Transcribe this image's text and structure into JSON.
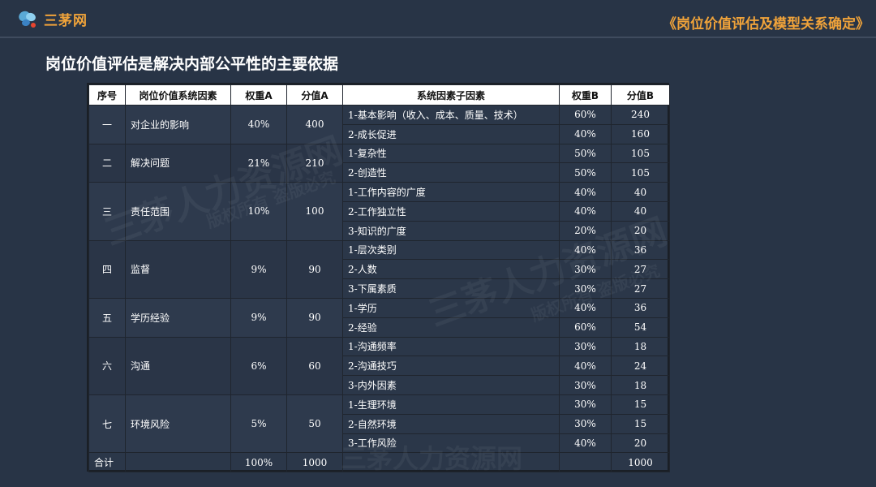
{
  "brand": {
    "name": "三茅网"
  },
  "header": {
    "title": "《岗位价值评估及模型关系确定》"
  },
  "page": {
    "title": "岗位价值评估是解决内部公平性的主要依据"
  },
  "table": {
    "headers": [
      "序号",
      "岗位价值系统因素",
      "权重A",
      "分值A",
      "系统因素子因素",
      "权重B",
      "分值B"
    ],
    "groups": [
      {
        "no": "一",
        "factor": "对企业的影响",
        "weight_a": "40%",
        "score_a": "400",
        "subs": [
          {
            "name": "1-基本影响（收入、成本、质量、技术）",
            "weight_b": "60%",
            "score_b": "240"
          },
          {
            "name": "2-成长促进",
            "weight_b": "40%",
            "score_b": "160"
          }
        ]
      },
      {
        "no": "二",
        "factor": "解决问题",
        "weight_a": "21%",
        "score_a": "210",
        "subs": [
          {
            "name": "1-复杂性",
            "weight_b": "50%",
            "score_b": "105"
          },
          {
            "name": "2-创造性",
            "weight_b": "50%",
            "score_b": "105"
          }
        ]
      },
      {
        "no": "三",
        "factor": "责任范围",
        "weight_a": "10%",
        "score_a": "100",
        "subs": [
          {
            "name": "1-工作内容的广度",
            "weight_b": "40%",
            "score_b": "40"
          },
          {
            "name": "2-工作独立性",
            "weight_b": "40%",
            "score_b": "40"
          },
          {
            "name": "3-知识的广度",
            "weight_b": "20%",
            "score_b": "20"
          }
        ]
      },
      {
        "no": "四",
        "factor": "监督",
        "weight_a": "9%",
        "score_a": "90",
        "subs": [
          {
            "name": "1-层次类别",
            "weight_b": "40%",
            "score_b": "36"
          },
          {
            "name": "2-人数",
            "weight_b": "30%",
            "score_b": "27"
          },
          {
            "name": "3-下属素质",
            "weight_b": "30%",
            "score_b": "27"
          }
        ]
      },
      {
        "no": "五",
        "factor": "学历经验",
        "weight_a": "9%",
        "score_a": "90",
        "subs": [
          {
            "name": "1-学历",
            "weight_b": "40%",
            "score_b": "36"
          },
          {
            "name": "2-经验",
            "weight_b": "60%",
            "score_b": "54"
          }
        ]
      },
      {
        "no": "六",
        "factor": "沟通",
        "weight_a": "6%",
        "score_a": "60",
        "subs": [
          {
            "name": "1-沟通频率",
            "weight_b": "30%",
            "score_b": "18"
          },
          {
            "name": "2-沟通技巧",
            "weight_b": "40%",
            "score_b": "24"
          },
          {
            "name": "3-内外因素",
            "weight_b": "30%",
            "score_b": "18"
          }
        ]
      },
      {
        "no": "七",
        "factor": "环境风险",
        "weight_a": "5%",
        "score_a": "50",
        "subs": [
          {
            "name": "1-生理环境",
            "weight_b": "30%",
            "score_b": "15"
          },
          {
            "name": "2-自然环境",
            "weight_b": "30%",
            "score_b": "15"
          },
          {
            "name": "3-工作风险",
            "weight_b": "40%",
            "score_b": "20"
          }
        ]
      }
    ],
    "total": {
      "label": "合计",
      "factor": "",
      "weight_a": "100%",
      "score_a": "1000",
      "sub": "",
      "weight_b": "",
      "score_b": "1000"
    }
  },
  "watermarks": [
    "三茅人力资源网",
    "版权所有 盗版必究",
    "三茅人力资源网",
    "版权所有 盗版必究",
    "三茅人力资源网"
  ],
  "colors": {
    "background": "#283446",
    "accent": "#f0a33a",
    "header_bg": "#ffffff"
  }
}
